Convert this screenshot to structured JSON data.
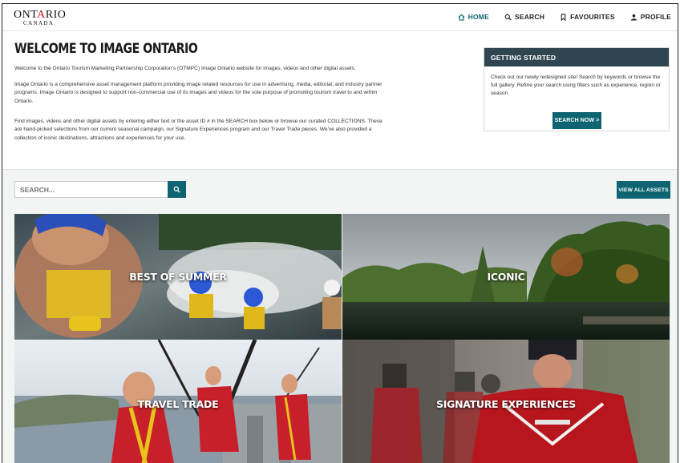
{
  "header": {
    "logo_main": "ONTARIO",
    "logo_sub": "CANADA",
    "nav": [
      {
        "label": "HOME",
        "icon": "home-icon",
        "active": true
      },
      {
        "label": "SEARCH",
        "icon": "search-icon",
        "active": false
      },
      {
        "label": "FAVOURITES",
        "icon": "bookmark-icon",
        "active": false
      },
      {
        "label": "PROFILE",
        "icon": "user-icon",
        "active": false
      }
    ]
  },
  "intro": {
    "title": "WELCOME TO IMAGE ONTARIO",
    "p1": "Welcome to the Ontario Tourism Marketing Partnership Corporation's (OTMPC) Image Ontario website for images, videos and other digital assets.",
    "p2": "Image Ontario is a comprehensive asset management platform providing  image related resources for use in advertising, media, editorial, and industry partner programs. Image Ontario is designed to support non-commercial use of its images and videos for the sole purpose of promoting tourism travel to and within Ontario.",
    "p3": "Find images, videos and other digital assets by entering either text or the asset ID # in the SEARCH box below or browse our curated COLLECTIONS. These are hand-picked selections from our current seasonal campaign, our Signature Experiences program and our Travel Trade pieces. We've also provided a collection of iconic destinations, attractions and experiences for your use."
  },
  "getting_started": {
    "title": "GETTING STARTED",
    "text": "Check out our newly redesigned site! Search by keywords or browse the full gallery. Refine your search using filters such as experience, region or season.",
    "button": "SEARCH NOW >"
  },
  "search": {
    "placeholder": "SEARCH...",
    "view_all": "VIEW ALL ASSETS"
  },
  "collections": [
    {
      "label": "BEST OF SUMMER"
    },
    {
      "label": "ICONIC"
    },
    {
      "label": "TRAVEL TRADE"
    },
    {
      "label": "SIGNATURE EXPERIENCES"
    }
  ],
  "colors": {
    "accent": "#0e6470",
    "panel_header": "#2f4550"
  }
}
